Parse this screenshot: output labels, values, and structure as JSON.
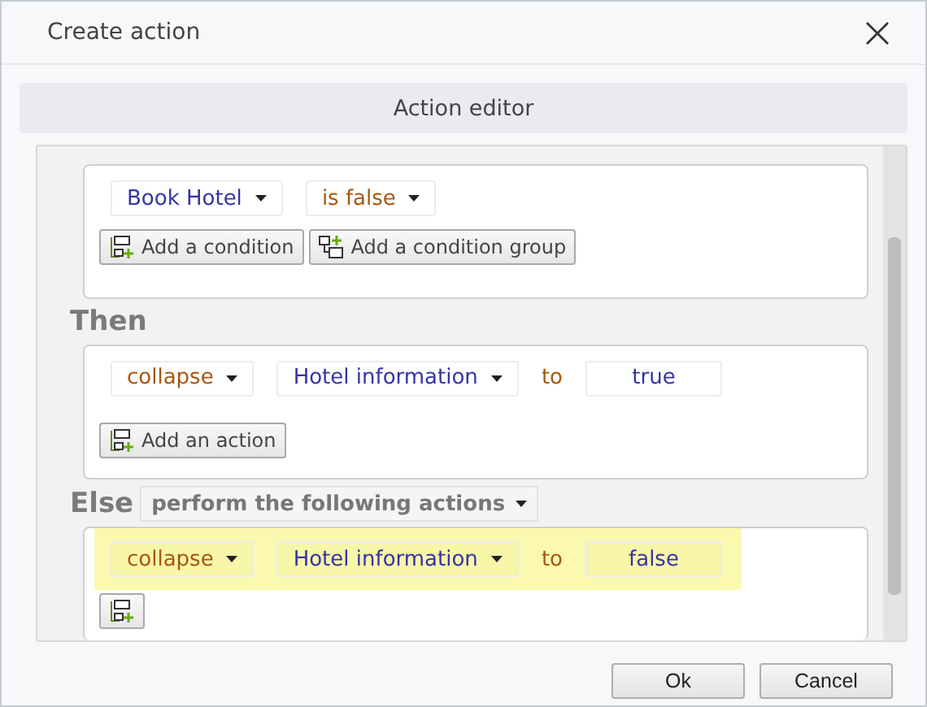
{
  "window": {
    "title": "Create action"
  },
  "section_header": "Action editor",
  "condition": {
    "fields": [
      {
        "kind": "dropdown",
        "text": "Book Hotel",
        "color": "#3434a8"
      },
      {
        "kind": "dropdown",
        "text": "is false",
        "color": "#a8560f"
      }
    ],
    "buttons": [
      {
        "kind": "condition",
        "label": "Add a condition"
      },
      {
        "kind": "group",
        "label": "Add a condition group"
      }
    ]
  },
  "then": {
    "label": "Then",
    "actions": [
      {
        "highlighted": false,
        "parts": [
          {
            "kind": "dropdown",
            "text": "collapse",
            "color": "#a8560f"
          },
          {
            "kind": "dropdown",
            "text": "Hotel information",
            "color": "#3434a8"
          },
          {
            "kind": "word",
            "text": "to",
            "color": "#a8560f"
          },
          {
            "kind": "value",
            "text": "true",
            "color": "#3434a8"
          }
        ]
      }
    ],
    "add_button": {
      "label": "Add an action"
    }
  },
  "else": {
    "label": "Else",
    "mode": "perform the following actions",
    "actions": [
      {
        "highlighted": true,
        "parts": [
          {
            "kind": "dropdown",
            "text": "collapse",
            "color": "#a8560f"
          },
          {
            "kind": "dropdown",
            "text": "Hotel information",
            "color": "#3434a8"
          },
          {
            "kind": "word",
            "text": "to",
            "color": "#a8560f"
          },
          {
            "kind": "value",
            "text": "false",
            "color": "#3434a8"
          }
        ]
      }
    ],
    "add_button_shown": true
  },
  "footer_buttons": [
    "Ok",
    "Cancel"
  ]
}
